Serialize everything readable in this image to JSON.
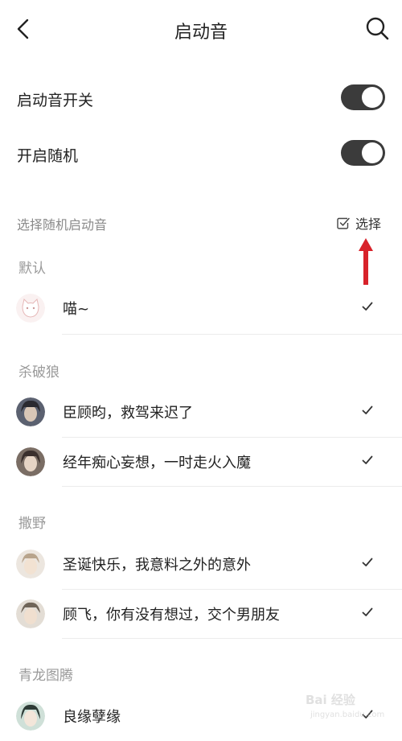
{
  "header": {
    "title": "启动音"
  },
  "settings": [
    {
      "label": "启动音开关",
      "on": true
    },
    {
      "label": "开启随机",
      "on": true
    }
  ],
  "random_section": {
    "label": "选择随机启动音",
    "select_label": "选择"
  },
  "groups": [
    {
      "title": "默认",
      "items": [
        {
          "name": "喵~",
          "checked": true
        }
      ]
    },
    {
      "title": "杀破狼",
      "items": [
        {
          "name": "臣顾昀，救驾来迟了",
          "checked": true
        },
        {
          "name": "经年痴心妄想，一时走火入魔",
          "checked": true
        }
      ]
    },
    {
      "title": "撒野",
      "items": [
        {
          "name": "圣诞快乐，我意料之外的意外",
          "checked": true
        },
        {
          "name": "顾飞，你有没有想过，交个男朋友",
          "checked": true
        }
      ]
    },
    {
      "title": "青龙图腾",
      "items": [
        {
          "name": "良缘孽缘",
          "checked": true
        }
      ]
    }
  ],
  "watermark": {
    "line1": "Bai 经验",
    "line2": "jingyan.baidu.com"
  },
  "colors": {
    "toggle_on": "#3b3b3b",
    "arrow": "#d8222a",
    "section_text": "#8a8a8a"
  }
}
